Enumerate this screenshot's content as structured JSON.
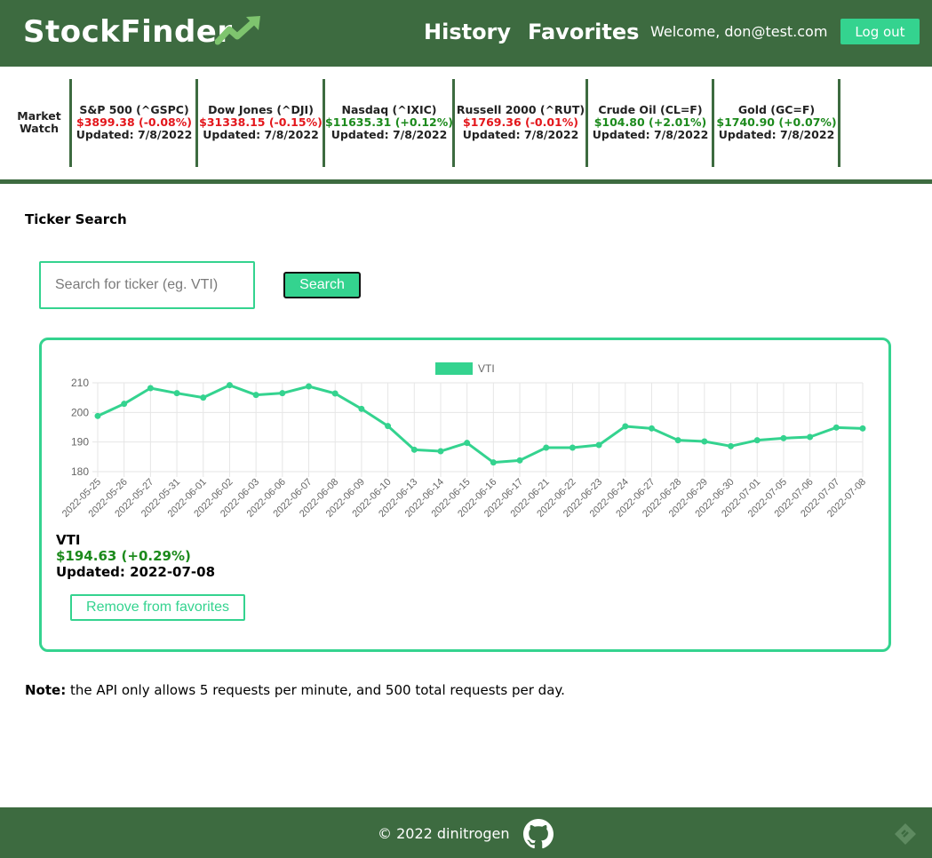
{
  "header": {
    "brand": "StockFinder",
    "nav": [
      "History",
      "Favorites"
    ],
    "welcome": "Welcome, don@test.com",
    "logout_label": "Log out",
    "colors": {
      "header_bg": "#3d6b40",
      "accent": "#34d38f"
    }
  },
  "market_watch": {
    "title_line1": "Market",
    "title_line2": "Watch",
    "items": [
      {
        "name": "S&P 500 (^GSPC)",
        "price": "$3899.38 (-0.08%)",
        "direction": "down",
        "updated": "Updated: 7/8/2022"
      },
      {
        "name": "Dow Jones (^DJI)",
        "price": "$31338.15 (-0.15%)",
        "direction": "down",
        "updated": "Updated: 7/8/2022"
      },
      {
        "name": "Nasdaq (^IXIC)",
        "price": "$11635.31 (+0.12%)",
        "direction": "up",
        "updated": "Updated: 7/8/2022"
      },
      {
        "name": "Russell 2000 (^RUT)",
        "price": "$1769.36 (-0.01%)",
        "direction": "down",
        "updated": "Updated: 7/8/2022"
      },
      {
        "name": "Crude Oil (CL=F)",
        "price": "$104.80 (+2.01%)",
        "direction": "up",
        "updated": "Updated: 7/8/2022"
      },
      {
        "name": "Gold (GC=F)",
        "price": "$1740.90 (+0.07%)",
        "direction": "up",
        "updated": "Updated: 7/8/2022"
      }
    ]
  },
  "search": {
    "section_title": "Ticker Search",
    "placeholder": "Search for ticker (eg. VTI)",
    "button_label": "Search"
  },
  "quote": {
    "symbol": "VTI",
    "price": "$194.63 (+0.29%)",
    "updated": "Updated: 2022-07-08",
    "favorite_button": "Remove from favorites"
  },
  "chart_data": {
    "type": "line",
    "series": [
      {
        "name": "VTI",
        "color": "#34d38f",
        "values": [
          198.8,
          202.9,
          208.2,
          206.5,
          205.0,
          209.2,
          205.9,
          206.5,
          208.8,
          206.4,
          201.2,
          195.4,
          187.4,
          186.9,
          189.7,
          183.1,
          183.8,
          188.1,
          188.1,
          189.0,
          195.3,
          194.6,
          190.6,
          190.2,
          188.6,
          190.6,
          191.3,
          191.7,
          194.9,
          194.6
        ]
      }
    ],
    "categories": [
      "2022-05-25",
      "2022-05-26",
      "2022-05-27",
      "2022-05-31",
      "2022-06-01",
      "2022-06-02",
      "2022-06-03",
      "2022-06-06",
      "2022-06-07",
      "2022-06-08",
      "2022-06-09",
      "2022-06-10",
      "2022-06-13",
      "2022-06-14",
      "2022-06-15",
      "2022-06-16",
      "2022-06-17",
      "2022-06-21",
      "2022-06-22",
      "2022-06-23",
      "2022-06-24",
      "2022-06-27",
      "2022-06-28",
      "2022-06-29",
      "2022-06-30",
      "2022-07-01",
      "2022-07-05",
      "2022-07-06",
      "2022-07-07",
      "2022-07-08"
    ],
    "ylim": [
      180,
      210
    ],
    "yticks": [
      180,
      190,
      200,
      210
    ],
    "grid": true,
    "legend": "top-center",
    "title": "",
    "xlabel": "",
    "ylabel": ""
  },
  "note": {
    "label": "Note:",
    "text": " the API only allows 5 requests per minute, and 500 total requests per day."
  },
  "footer": {
    "copyright": "© 2022 dinitrogen",
    "icons": [
      "github-icon",
      "feedly-icon"
    ]
  }
}
